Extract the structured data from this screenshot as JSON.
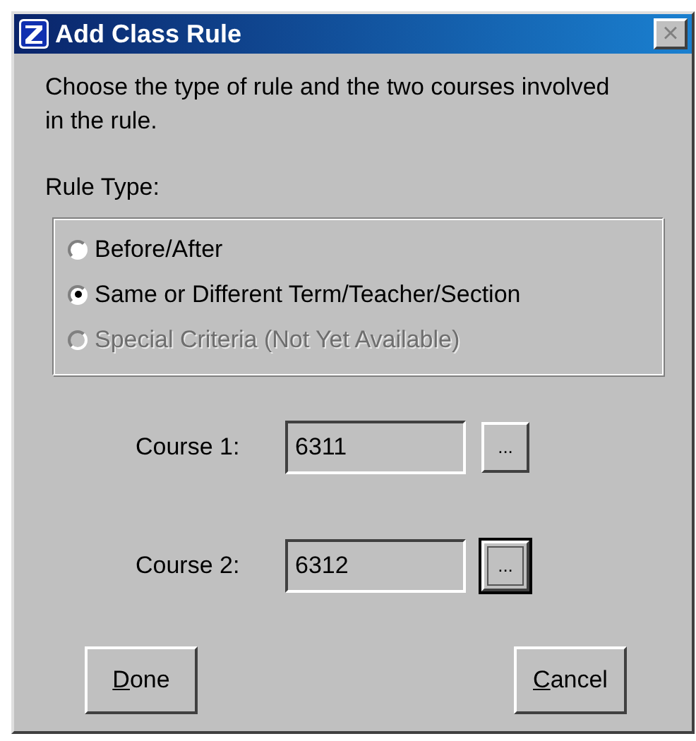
{
  "window": {
    "title": "Add Class Rule",
    "close_glyph": "×"
  },
  "instructions": "Choose the type of rule and the two courses involved in the rule.",
  "rule_type": {
    "label": "Rule Type:",
    "options": [
      {
        "label": "Before/After",
        "selected": false,
        "disabled": false
      },
      {
        "label": "Same or Different Term/Teacher/Section",
        "selected": true,
        "disabled": false
      },
      {
        "label": "Special Criteria (Not Yet Available)",
        "selected": false,
        "disabled": true
      }
    ]
  },
  "courses": [
    {
      "label": "Course 1:",
      "value": "6311",
      "browse": "...",
      "focused": false
    },
    {
      "label": "Course 2:",
      "value": "6312",
      "browse": "...",
      "focused": true
    }
  ],
  "buttons": [
    {
      "label": "Done",
      "underline_first": true
    },
    {
      "label": "Cancel",
      "underline_first": true
    }
  ]
}
